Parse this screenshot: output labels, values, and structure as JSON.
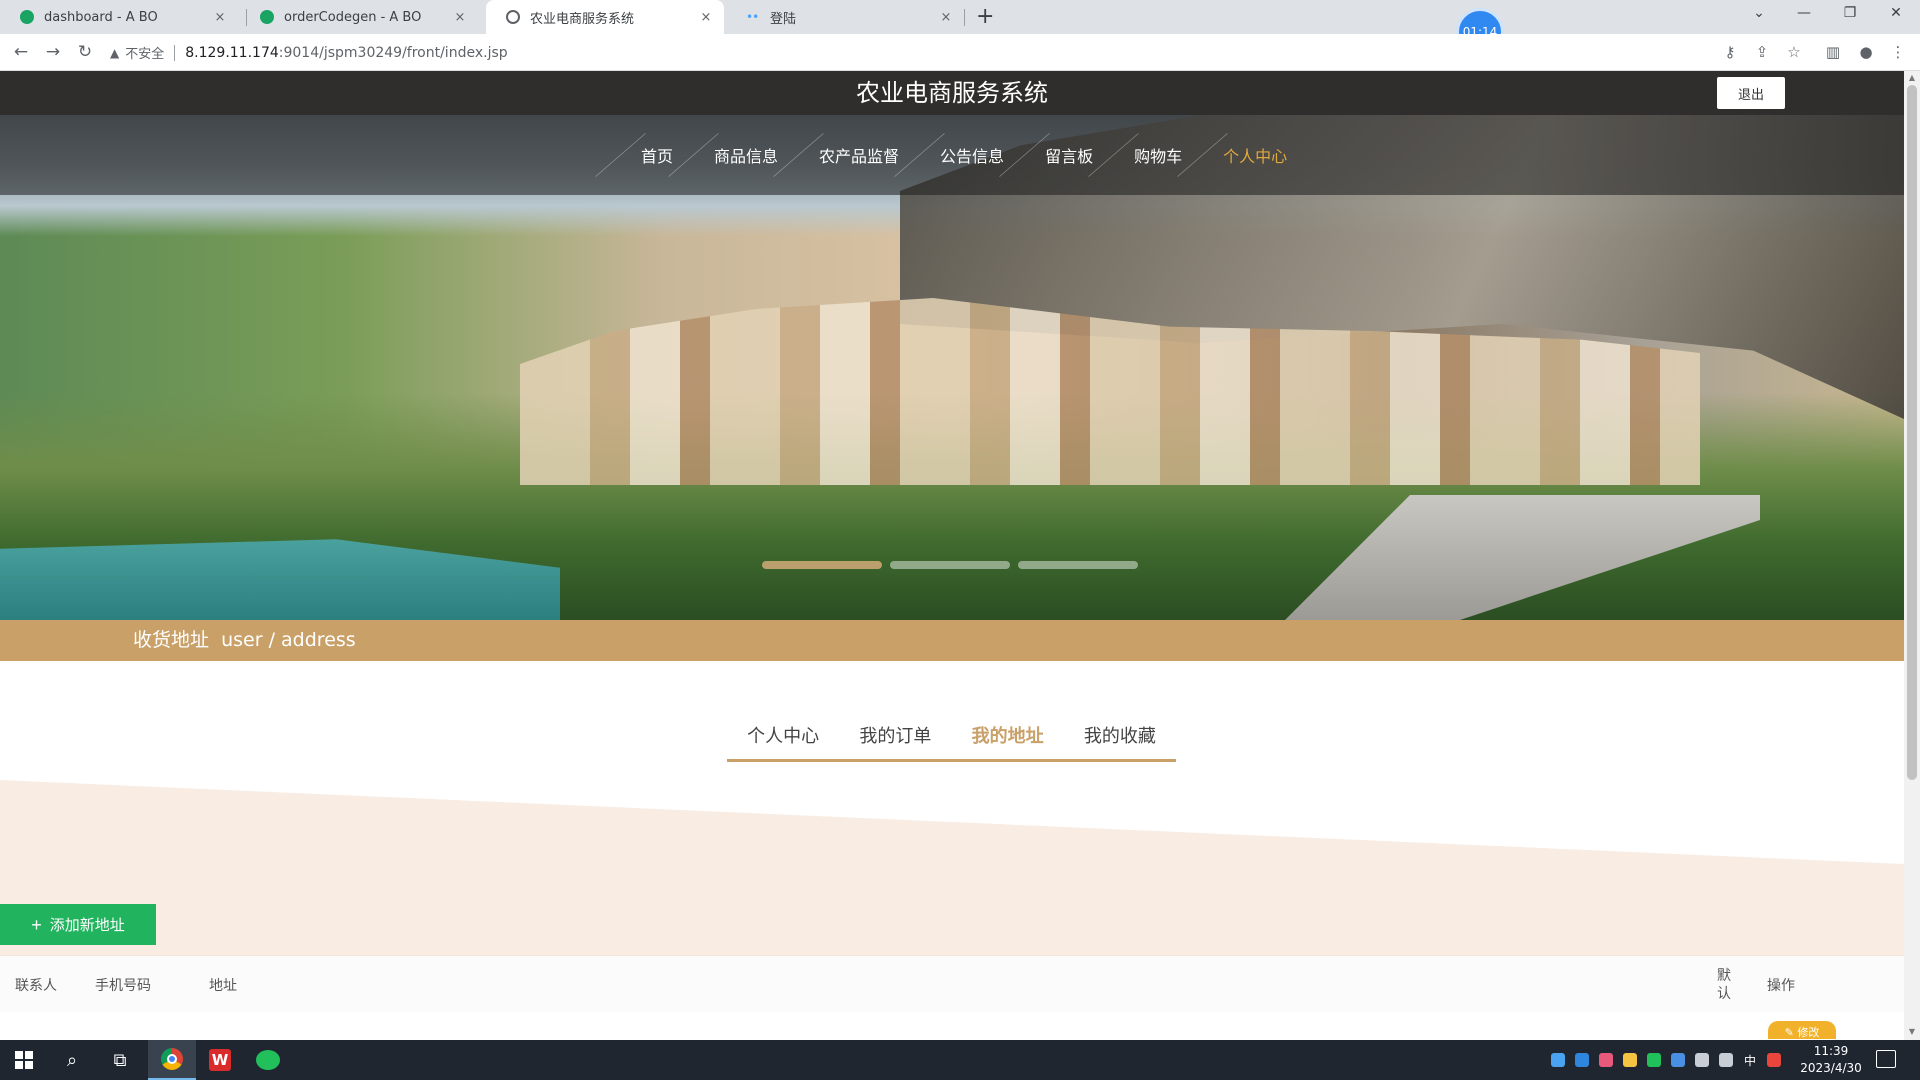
{
  "browser": {
    "tabs": [
      {
        "title": "dashboard - A BO",
        "favicon": "green-leaf-icon"
      },
      {
        "title": "orderCodegen - A BO",
        "favicon": "green-leaf-icon"
      },
      {
        "title": "农业电商服务系统",
        "favicon": "globe-icon"
      },
      {
        "title": "登陆",
        "favicon": "loading-dots-icon"
      }
    ],
    "new_tab": "+",
    "close_glyph": "×",
    "security_label": "不安全",
    "url_host": "8.129.11.174",
    "url_path": ":9014/jspm30249/front/index.jsp",
    "timer": "01:14"
  },
  "site": {
    "title": "农业电商服务系统",
    "logout": "退出",
    "nav": [
      "首页",
      "商品信息",
      "农产品监督",
      "公告信息",
      "留言板",
      "购物车",
      "个人中心"
    ],
    "nav_active_index": 6,
    "section_title": "收货地址",
    "section_subtitle": "user / address",
    "sub_nav": [
      "个人中心",
      "我的订单",
      "我的地址",
      "我的收藏"
    ],
    "sub_nav_active_index": 2,
    "add_button": "添加新地址",
    "table_headers": {
      "contact": "联系人",
      "phone": "手机号码",
      "address": "地址",
      "default": "默认",
      "actions": "操作"
    },
    "edit_chip": "✎ 修改"
  },
  "taskbar": {
    "time": "11:39",
    "date": "2023/4/30",
    "ime": "中"
  },
  "colors": {
    "accent": "#c9a068",
    "nav_active": "#e0a83d",
    "add_button": "#22b35e",
    "header_bg": "#2f2e2c"
  }
}
